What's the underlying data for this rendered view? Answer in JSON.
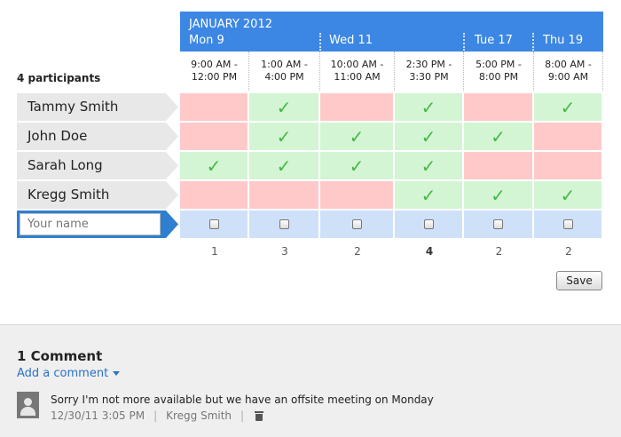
{
  "header": {
    "month": "JANUARY 2012",
    "days": [
      {
        "label": "Mon 9"
      },
      {
        "label": "Wed 11"
      },
      {
        "label": "Tue 17"
      },
      {
        "label": "Thu 19"
      }
    ]
  },
  "slots": [
    {
      "time": "9:00 AM -\n12:00 PM",
      "count": "1"
    },
    {
      "time": "1:00 AM -\n4:00 PM",
      "count": "3"
    },
    {
      "time": "10:00 AM -\n11:00 AM",
      "count": "2"
    },
    {
      "time": "2:30 PM -\n3:30 PM",
      "count": "4"
    },
    {
      "time": "5:00 PM -\n8:00 PM",
      "count": "2"
    },
    {
      "time": "8:00 AM -\n9:00 AM",
      "count": "2"
    }
  ],
  "participants_label": "4 participants",
  "participants": [
    {
      "name": "Tammy Smith",
      "availability": [
        false,
        true,
        false,
        true,
        false,
        true
      ]
    },
    {
      "name": "John Doe",
      "availability": [
        false,
        true,
        true,
        true,
        true,
        false
      ]
    },
    {
      "name": "Sarah Long",
      "availability": [
        true,
        true,
        true,
        true,
        false,
        false
      ]
    },
    {
      "name": "Kregg Smith",
      "availability": [
        false,
        false,
        false,
        true,
        true,
        true
      ]
    }
  ],
  "your_name": {
    "placeholder": "Your name",
    "value": ""
  },
  "check_glyph": "✓",
  "save_label": "Save",
  "comments": {
    "title": "1 Comment",
    "add_label": "Add a comment",
    "items": [
      {
        "text": "Sorry I'm not more available but we have an offsite meeting on Monday",
        "date": "12/30/11 3:05 PM",
        "sep": "|",
        "author": "Kregg Smith"
      }
    ]
  },
  "colors": {
    "header": "#3d87e4",
    "available": "#d3f5d3",
    "unavailable": "#ffc9c9",
    "input_row": "#cfe0f9",
    "link": "#2a72c9"
  }
}
